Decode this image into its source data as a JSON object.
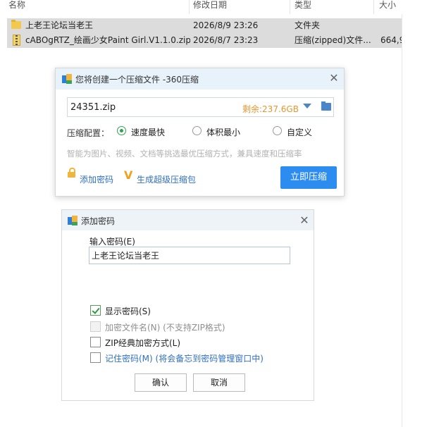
{
  "explorer": {
    "columns": {
      "name": "名称",
      "modified": "修改日期",
      "type": "类型",
      "size": "大小"
    },
    "files": [
      {
        "name": "上老王论坛当老王",
        "modified": "2026/8/9 23:26",
        "type": "文件夹",
        "size": "",
        "icon": "folder-icon"
      },
      {
        "name": "cABOgRTZ_绘画少女Paint Girl.V1.1.0.zip",
        "modified": "2026/8/7 23:23",
        "type": "压缩(zipped)文件...",
        "size": "664,9",
        "icon": "zip-icon"
      }
    ]
  },
  "compress_dialog": {
    "title": "您将创建一个压缩文件 -360压缩",
    "filename": "24351.zip",
    "remaining": "剩余:237.6GB",
    "config_label": "压缩配置：",
    "options": [
      "速度最快",
      "体积最小",
      "自定义"
    ],
    "selected_option": "速度最快",
    "hint": "智能为图片、视频、文档等挑选最优压缩方式，兼具速度和压缩率",
    "add_password": "添加密码",
    "super_pack": "生成超级压缩包",
    "compress_button": "立即压缩",
    "accent_color": "#2d8cf0"
  },
  "password_dialog": {
    "title": "添加密码",
    "input_label": "输入密码(E)",
    "password_value": "上老王论坛当老王",
    "checkboxes": [
      {
        "label": "显示密码(S)",
        "checked": true,
        "disabled": false
      },
      {
        "label": "加密文件名(N) (不支持ZIP格式)",
        "checked": false,
        "disabled": true
      },
      {
        "label": "ZIP经典加密方式(L)",
        "checked": false,
        "disabled": false
      },
      {
        "label": "记住密码(M) (将会备忘到密码管理窗口中)",
        "checked": false,
        "disabled": false
      }
    ],
    "ok_button": "确认",
    "cancel_button": "取消"
  }
}
